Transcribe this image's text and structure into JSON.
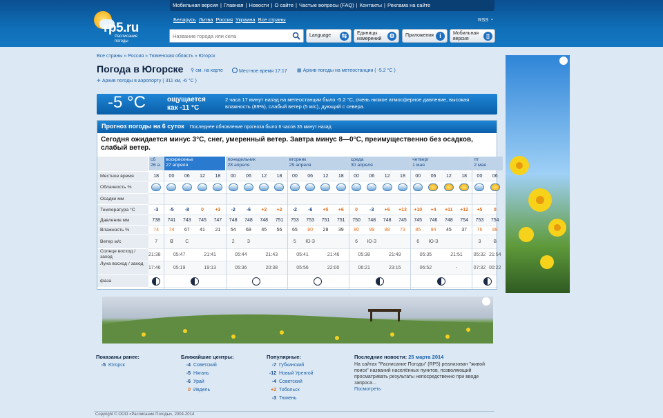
{
  "header": {
    "logo_name": "rp5.ru",
    "logo_sub": "Расписание погоды",
    "topnav": [
      "Мобильная версия",
      "|",
      "Главная",
      "|",
      "Новости",
      "|",
      "О сайте",
      "|",
      "Частые вопросы (FAQ)",
      "|",
      "Контакты",
      "|",
      "Реклама на сайте"
    ],
    "countries": [
      "Беларусь",
      "Литва",
      "Россия",
      "Украина",
      "Все страны"
    ],
    "rss": "RSS",
    "search_placeholder": "Название города или села",
    "buttons": {
      "language": "Language",
      "units": "Единицы измерений",
      "apps": "Приложения",
      "mobile": "Мобильная версия"
    }
  },
  "breadcrumb": "Все страны » Россия » Тюменская область » Югорск",
  "title": "Погода в Югорске",
  "meta": {
    "map": "см. на карте",
    "local_time": "Местное время 17:17",
    "archive": "Архив погоды на метеостанции ( -5.2 °C )",
    "airport": "Архив погоды в аэропорту ( 311 км, -6 °C )"
  },
  "now": {
    "temp": "-5 °C",
    "feels": "ощущается",
    "feels_val": "как -11 °C",
    "desc": "2 часа 17 минут назад на метеостанции было -5.2 °C, очень низкое атмосферное давление, высокая влажность (89%), слабый ветер (5 м/с), дующий с севера."
  },
  "forecast": {
    "title": "Прогноз погоды на 6 суток",
    "updated": "Последнее обновление прогноза было 6 часов 35 минут назад",
    "summary": "Сегодня ожидается минус 3°C, снег, умеренный ветер. Завтра минус 8—0°C, преимущественно без осадков, слабый ветер.",
    "labels": [
      "Местное время",
      "Облачность %",
      "Осадки мм",
      "Температура °C",
      "Давление мм",
      "Влажность %",
      "Ветер м/с",
      "Солнце восход / заход",
      "Луна восход / заход",
      "фаза"
    ],
    "days": [
      {
        "name": "сб",
        "date": "26 а.",
        "cols": [
          "18"
        ],
        "temp": [
          "-3"
        ],
        "pres": [
          "738"
        ],
        "hum": [
          "74"
        ],
        "wind": [
          "7",
          "С"
        ],
        "sun": [
          "21:38",
          ""
        ],
        "moon": [
          "17:46",
          ""
        ]
      },
      {
        "name": "воскресенье",
        "date": "27 апреля",
        "cols": [
          "00",
          "06",
          "12",
          "18"
        ],
        "temp": [
          "-5",
          "-8",
          "0",
          "+3"
        ],
        "pres": [
          "741",
          "743",
          "745",
          "747"
        ],
        "hum": [
          "74",
          "67",
          "41",
          "21"
        ],
        "wind": [
          "3",
          "С",
          "2",
          "Ю-З"
        ],
        "sun": [
          "05:47",
          "21:41"
        ],
        "moon": [
          "05:19",
          "19:13"
        ]
      },
      {
        "name": "понедельник",
        "date": "28 апреля",
        "cols": [
          "00",
          "06",
          "12",
          "18"
        ],
        "temp": [
          "-2",
          "-6",
          "+2",
          "+2"
        ],
        "pres": [
          "748",
          "748",
          "748",
          "751"
        ],
        "hum": [
          "54",
          "68",
          "45",
          "56"
        ],
        "wind": [
          "2",
          "З",
          "2",
          "Ю-З"
        ],
        "sun": [
          "05:44",
          "21:43"
        ],
        "moon": [
          "05:36",
          "20:38"
        ]
      },
      {
        "name": "вторник",
        "date": "29 апреля",
        "cols": [
          "00",
          "06",
          "12",
          "18"
        ],
        "temp": [
          "-2",
          "-6",
          "+5",
          "+6"
        ],
        "pres": [
          "753",
          "753",
          "751",
          "751"
        ],
        "hum": [
          "65",
          "80",
          "28",
          "39"
        ],
        "wind": [
          "5",
          "Ю-З",
          "4",
          "Ю-З"
        ],
        "sun": [
          "05:41",
          "21:46"
        ],
        "moon": [
          "05:56",
          "22:00"
        ]
      },
      {
        "name": "среда",
        "date": "30 апреля",
        "cols": [
          "00",
          "06",
          "12",
          "18"
        ],
        "temp": [
          "0",
          "-3",
          "+6",
          "+13"
        ],
        "pres": [
          "750",
          "748",
          "748",
          "745"
        ],
        "hum": [
          "80",
          "99",
          "88",
          "73"
        ],
        "wind": [
          "6",
          "Ю-З",
          "5",
          "Ю-З"
        ],
        "sun": [
          "05:38",
          "21:49"
        ],
        "moon": [
          "06:21",
          "23:15"
        ]
      },
      {
        "name": "четверг",
        "date": "1 мая",
        "cols": [
          "00",
          "06",
          "12",
          "18"
        ],
        "temp": [
          "+10",
          "+4",
          "+11",
          "+12"
        ],
        "pres": [
          "745",
          "746",
          "748",
          "754"
        ],
        "hum": [
          "85",
          "94",
          "45",
          "37"
        ],
        "wind": [
          "6",
          "Ю-З",
          "4",
          "С-З"
        ],
        "sun": [
          "05:35",
          "21:51"
        ],
        "moon": [
          "06:52",
          "-"
        ]
      },
      {
        "name": "пт",
        "date": "2 мая",
        "cols": [
          "00",
          "06"
        ],
        "temp": [
          "+5",
          "0"
        ],
        "pres": [
          "753",
          "754"
        ],
        "hum": [
          "76",
          "88"
        ],
        "wind": [
          "3",
          "В"
        ],
        "sun": [
          "05:32",
          "21:54"
        ],
        "moon": [
          "07:32",
          "00:22"
        ]
      }
    ]
  },
  "footer": {
    "recent": {
      "title": "Показаны ранее:",
      "items": [
        {
          "t": "-5",
          "name": "Югорск"
        }
      ]
    },
    "near": {
      "title": "Ближайшие центры:",
      "items": [
        {
          "t": "-4",
          "name": "Советский"
        },
        {
          "t": "-5",
          "name": "Нягань"
        },
        {
          "t": "-6",
          "name": "Урай"
        },
        {
          "t": "0",
          "name": "Ивдель"
        }
      ]
    },
    "popular": {
      "title": "Популярные:",
      "items": [
        {
          "t": "-7",
          "name": "Губкинский"
        },
        {
          "t": "-12",
          "name": "Новый Уренгой"
        },
        {
          "t": "-4",
          "name": "Советский"
        },
        {
          "t": "+2",
          "name": "Тобольск"
        },
        {
          "t": "-3",
          "name": "Тюмень"
        }
      ]
    },
    "news": {
      "title": "Последние новости:",
      "date": "25 марта 2014",
      "text": "На сайтах \"Расписание Погоды\" (RP5) реализован \"живой поиск\" названий населённых пунктов, позволяющий просматривать результаты непосредственно при вводе запроса...",
      "link": "Посмотреть"
    },
    "copyright": "Copyright © ООО «Расписание Погоды», 2004-2014"
  },
  "colors": {
    "accent": "#0a5ea8",
    "warm": "#e0701e",
    "cold": "#1a4a88"
  }
}
